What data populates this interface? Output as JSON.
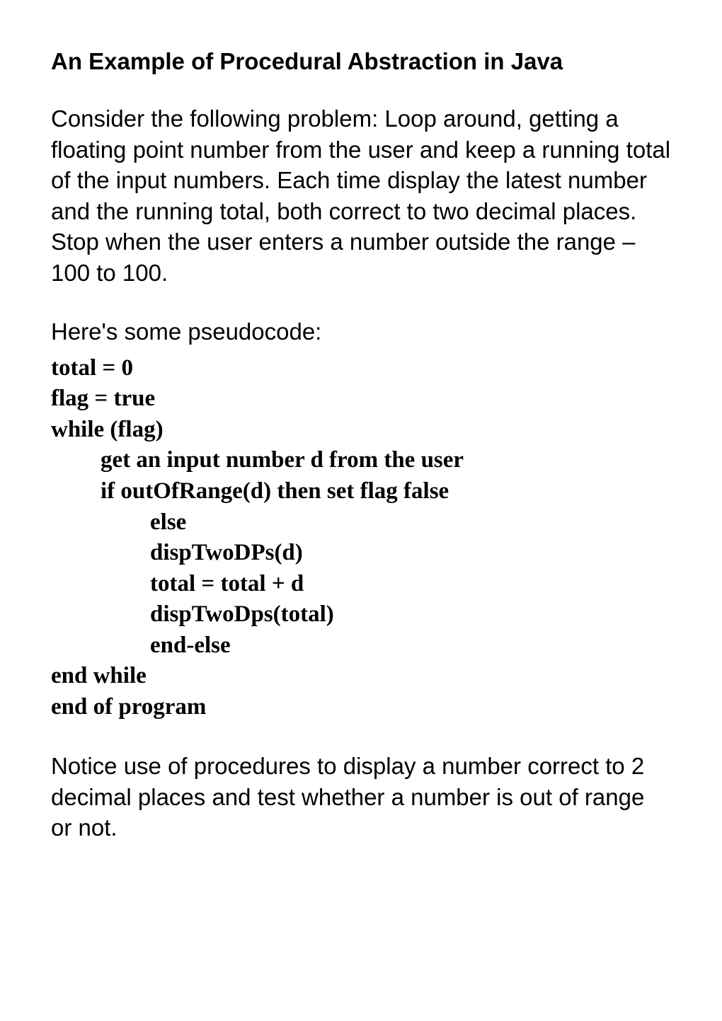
{
  "title": "An Example of Procedural Abstraction in Java",
  "intro": "Consider the following problem:\nLoop around, getting a floating point number from the user and keep a running total of the input numbers. Each time display the latest number and the running total, both correct to two decimal places. Stop when the user enters a number outside the range –100 to 100.",
  "pseudocode_intro": "Here's some pseudocode:",
  "pseudocode": {
    "l0": "total = 0",
    "l1": "flag = true",
    "l2": "while (flag)",
    "l3": "get an input number d from the user",
    "l4": "if outOfRange(d) then set flag false",
    "l5": "else",
    "l6": "dispTwoDPs(d)",
    "l7": "total = total + d",
    "l8": "dispTwoDps(total)",
    "l9": "end-else",
    "l10": "end while",
    "l11": "end of program"
  },
  "closing": "Notice use of procedures to display a number correct to 2 decimal places and test whether a number is out of range or not."
}
